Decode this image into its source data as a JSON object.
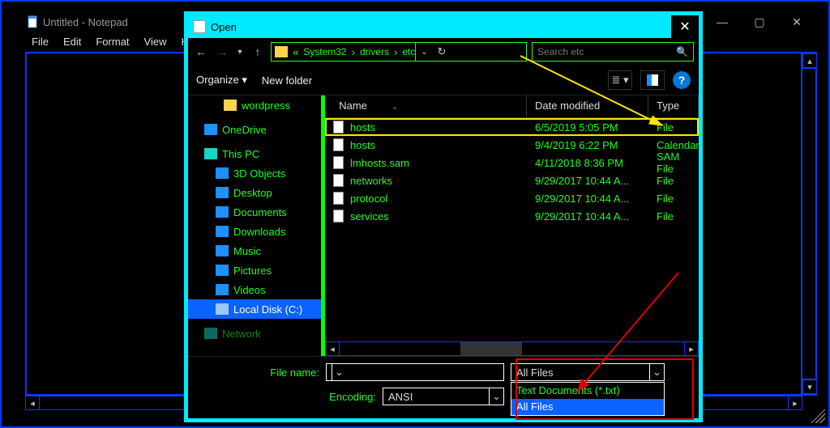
{
  "notepad": {
    "title": "Untitled - Notepad",
    "menu": {
      "file": "File",
      "edit": "Edit",
      "format": "Format",
      "view": "View",
      "help": "Help"
    }
  },
  "dialog": {
    "title": "Open",
    "breadcrumb": [
      "System32",
      "drivers",
      "etc"
    ],
    "search_placeholder": "Search etc",
    "toolbar": {
      "organize": "Organize",
      "new_folder": "New folder"
    },
    "columns": {
      "name": "Name",
      "date": "Date modified",
      "type": "Type"
    },
    "sidebar": [
      {
        "label": "wordpress",
        "kind": "folder",
        "lvl": 2
      },
      {
        "label": "OneDrive",
        "kind": "onedrive",
        "lvl": 0,
        "spacer": true
      },
      {
        "label": "This PC",
        "kind": "thispc",
        "lvl": 0,
        "spacer": true
      },
      {
        "label": "3D Objects",
        "kind": "blue",
        "lvl": 1
      },
      {
        "label": "Desktop",
        "kind": "blue",
        "lvl": 1
      },
      {
        "label": "Documents",
        "kind": "blue",
        "lvl": 1
      },
      {
        "label": "Downloads",
        "kind": "blue",
        "lvl": 1
      },
      {
        "label": "Music",
        "kind": "blue",
        "lvl": 1
      },
      {
        "label": "Pictures",
        "kind": "blue",
        "lvl": 1
      },
      {
        "label": "Videos",
        "kind": "blue",
        "lvl": 1
      },
      {
        "label": "Local Disk (C:)",
        "kind": "drive",
        "lvl": 1,
        "selected": true
      },
      {
        "label": "Network",
        "kind": "teal",
        "lvl": 0,
        "spacer": true,
        "dim": true
      }
    ],
    "files": [
      {
        "name": "hosts",
        "date": "6/5/2019 5:05 PM",
        "type": "File",
        "hl": true
      },
      {
        "name": "hosts",
        "date": "9/4/2019 6:22 PM",
        "type": "Calendar"
      },
      {
        "name": "lmhosts.sam",
        "date": "4/11/2018 8:36 PM",
        "type": "SAM File"
      },
      {
        "name": "networks",
        "date": "9/29/2017 10:44 A...",
        "type": "File"
      },
      {
        "name": "protocol",
        "date": "9/29/2017 10:44 A...",
        "type": "File"
      },
      {
        "name": "services",
        "date": "9/29/2017 10:44 A...",
        "type": "File"
      }
    ],
    "form": {
      "filename_label": "File name:",
      "filename_value": "",
      "type_value": "All Files",
      "type_options": [
        "Text Documents (*.txt)",
        "All Files"
      ],
      "encoding_label": "Encoding:",
      "encoding_value": "ANSI"
    }
  }
}
